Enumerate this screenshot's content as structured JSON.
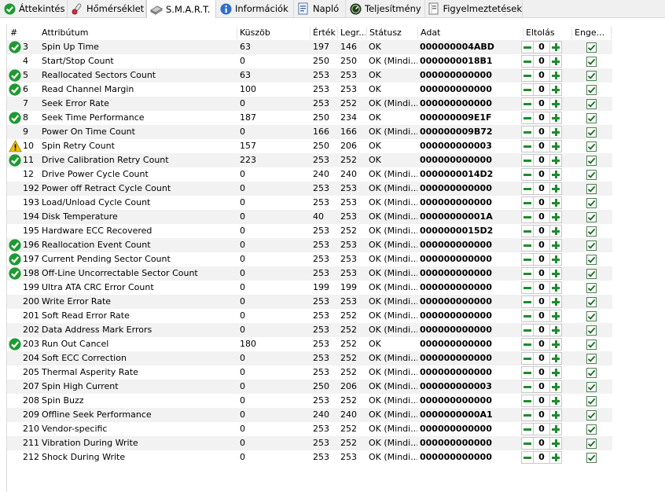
{
  "tabs": [
    {
      "label": "Áttekintés",
      "icon": "check-circle-icon",
      "active": false
    },
    {
      "label": "Hőmérséklet",
      "icon": "thermometer-icon",
      "active": false
    },
    {
      "label": "S.M.A.R.T.",
      "icon": "drive-icon",
      "active": true
    },
    {
      "label": "Információk",
      "icon": "info-icon",
      "active": false
    },
    {
      "label": "Napló",
      "icon": "log-icon",
      "active": false
    },
    {
      "label": "Teljesítmény",
      "icon": "performance-icon",
      "active": false
    },
    {
      "label": "Figyelmeztetések",
      "icon": "warnings-icon",
      "active": false
    }
  ],
  "columns": {
    "num": "#",
    "attr": "Attribútum",
    "threshold": "Küszöb",
    "value": "Érték",
    "worst": "Legr...",
    "status": "Státusz",
    "data": "Adat",
    "offset": "Eltolás",
    "enabled": "Enge..."
  },
  "colors": {
    "ok": "#1f9a33",
    "warn": "#f2c200",
    "stepper": "#1e8c2e",
    "row_alt": "#f2f2f2"
  },
  "rows": [
    {
      "id": "3",
      "name": "Spin Up Time",
      "threshold": "63",
      "value": "197",
      "worst": "146",
      "status": "OK",
      "data": "000000004ABD",
      "offset": "0",
      "icon": "ok"
    },
    {
      "id": "4",
      "name": "Start/Stop Count",
      "threshold": "0",
      "value": "250",
      "worst": "250",
      "status": "OK (Mindi...",
      "data": "0000000018B1",
      "offset": "0",
      "icon": ""
    },
    {
      "id": "5",
      "name": "Reallocated Sectors Count",
      "threshold": "63",
      "value": "253",
      "worst": "253",
      "status": "OK",
      "data": "000000000000",
      "offset": "0",
      "icon": "ok"
    },
    {
      "id": "6",
      "name": "Read Channel Margin",
      "threshold": "100",
      "value": "253",
      "worst": "253",
      "status": "OK",
      "data": "000000000000",
      "offset": "0",
      "icon": "ok"
    },
    {
      "id": "7",
      "name": "Seek Error Rate",
      "threshold": "0",
      "value": "253",
      "worst": "252",
      "status": "OK (Mindi...",
      "data": "000000000000",
      "offset": "0",
      "icon": ""
    },
    {
      "id": "8",
      "name": "Seek Time Performance",
      "threshold": "187",
      "value": "250",
      "worst": "234",
      "status": "OK",
      "data": "000000009E1F",
      "offset": "0",
      "icon": "ok"
    },
    {
      "id": "9",
      "name": "Power On Time Count",
      "threshold": "0",
      "value": "166",
      "worst": "166",
      "status": "OK (Mindi...",
      "data": "000000009B72",
      "offset": "0",
      "icon": ""
    },
    {
      "id": "10",
      "name": "Spin Retry Count",
      "threshold": "157",
      "value": "250",
      "worst": "206",
      "status": "OK",
      "data": "000000000003",
      "offset": "0",
      "icon": "warn"
    },
    {
      "id": "11",
      "name": "Drive Calibration Retry Count",
      "threshold": "223",
      "value": "253",
      "worst": "252",
      "status": "OK",
      "data": "000000000000",
      "offset": "0",
      "icon": "ok"
    },
    {
      "id": "12",
      "name": "Drive Power Cycle Count",
      "threshold": "0",
      "value": "240",
      "worst": "240",
      "status": "OK (Mindi...",
      "data": "0000000014D2",
      "offset": "0",
      "icon": ""
    },
    {
      "id": "192",
      "name": "Power off Retract Cycle Count",
      "threshold": "0",
      "value": "253",
      "worst": "253",
      "status": "OK (Mindi...",
      "data": "000000000000",
      "offset": "0",
      "icon": ""
    },
    {
      "id": "193",
      "name": "Load/Unload Cycle Count",
      "threshold": "0",
      "value": "253",
      "worst": "253",
      "status": "OK (Mindi...",
      "data": "000000000000",
      "offset": "0",
      "icon": ""
    },
    {
      "id": "194",
      "name": "Disk Temperature",
      "threshold": "0",
      "value": "40",
      "worst": "253",
      "status": "OK (Mindi...",
      "data": "00000000001A",
      "offset": "0",
      "icon": ""
    },
    {
      "id": "195",
      "name": "Hardware ECC Recovered",
      "threshold": "0",
      "value": "253",
      "worst": "252",
      "status": "OK (Mindi...",
      "data": "0000000015D2",
      "offset": "0",
      "icon": ""
    },
    {
      "id": "196",
      "name": "Reallocation Event Count",
      "threshold": "0",
      "value": "253",
      "worst": "253",
      "status": "OK (Mindi...",
      "data": "000000000000",
      "offset": "0",
      "icon": "ok"
    },
    {
      "id": "197",
      "name": "Current Pending Sector Count",
      "threshold": "0",
      "value": "253",
      "worst": "253",
      "status": "OK (Mindi...",
      "data": "000000000000",
      "offset": "0",
      "icon": "ok"
    },
    {
      "id": "198",
      "name": "Off-Line Uncorrectable Sector Count",
      "threshold": "0",
      "value": "253",
      "worst": "253",
      "status": "OK (Mindi...",
      "data": "000000000000",
      "offset": "0",
      "icon": "ok"
    },
    {
      "id": "199",
      "name": "Ultra ATA CRC Error Count",
      "threshold": "0",
      "value": "199",
      "worst": "199",
      "status": "OK (Mindi...",
      "data": "000000000000",
      "offset": "0",
      "icon": ""
    },
    {
      "id": "200",
      "name": "Write Error Rate",
      "threshold": "0",
      "value": "253",
      "worst": "253",
      "status": "OK (Mindi...",
      "data": "000000000000",
      "offset": "0",
      "icon": ""
    },
    {
      "id": "201",
      "name": "Soft Read Error Rate",
      "threshold": "0",
      "value": "253",
      "worst": "252",
      "status": "OK (Mindi...",
      "data": "000000000000",
      "offset": "0",
      "icon": ""
    },
    {
      "id": "202",
      "name": "Data Address Mark Errors",
      "threshold": "0",
      "value": "253",
      "worst": "252",
      "status": "OK (Mindi...",
      "data": "000000000000",
      "offset": "0",
      "icon": ""
    },
    {
      "id": "203",
      "name": "Run Out Cancel",
      "threshold": "180",
      "value": "253",
      "worst": "252",
      "status": "OK",
      "data": "000000000000",
      "offset": "0",
      "icon": "ok"
    },
    {
      "id": "204",
      "name": "Soft ECC Correction",
      "threshold": "0",
      "value": "253",
      "worst": "252",
      "status": "OK (Mindi...",
      "data": "000000000000",
      "offset": "0",
      "icon": ""
    },
    {
      "id": "205",
      "name": "Thermal Asperity Rate",
      "threshold": "0",
      "value": "253",
      "worst": "252",
      "status": "OK (Mindi...",
      "data": "000000000000",
      "offset": "0",
      "icon": ""
    },
    {
      "id": "207",
      "name": "Spin High Current",
      "threshold": "0",
      "value": "250",
      "worst": "206",
      "status": "OK (Mindi...",
      "data": "000000000003",
      "offset": "0",
      "icon": ""
    },
    {
      "id": "208",
      "name": "Spin Buzz",
      "threshold": "0",
      "value": "253",
      "worst": "252",
      "status": "OK (Mindi...",
      "data": "000000000000",
      "offset": "0",
      "icon": ""
    },
    {
      "id": "209",
      "name": "Offline Seek Performance",
      "threshold": "0",
      "value": "240",
      "worst": "240",
      "status": "OK (Mindi...",
      "data": "0000000000A1",
      "offset": "0",
      "icon": ""
    },
    {
      "id": "210",
      "name": "Vendor-specific",
      "threshold": "0",
      "value": "253",
      "worst": "252",
      "status": "OK (Mindi...",
      "data": "000000000000",
      "offset": "0",
      "icon": ""
    },
    {
      "id": "211",
      "name": "Vibration During Write",
      "threshold": "0",
      "value": "253",
      "worst": "252",
      "status": "OK (Mindi...",
      "data": "000000000000",
      "offset": "0",
      "icon": ""
    },
    {
      "id": "212",
      "name": "Shock During Write",
      "threshold": "0",
      "value": "253",
      "worst": "253",
      "status": "OK (Mindi...",
      "data": "000000000000",
      "offset": "0",
      "icon": ""
    }
  ]
}
